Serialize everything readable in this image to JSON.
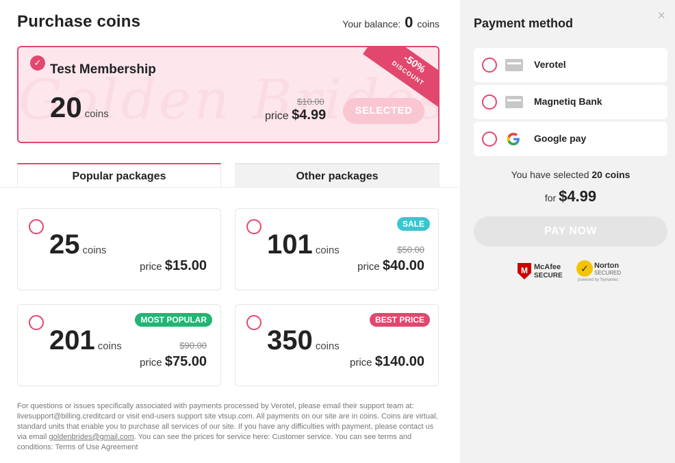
{
  "header": {
    "title": "Purchase coins",
    "balance_label": "Your balance:",
    "balance_value": "0",
    "balance_unit": "coins"
  },
  "membership": {
    "name": "Test Membership",
    "coins": "20",
    "coins_word": "coins",
    "old_price": "$10.00",
    "price_label": "price",
    "price": "$4.99",
    "button": "SELECTED",
    "discount": "-50%",
    "discount_label": "DISCOUNT",
    "watermark": "Golden Brides",
    "checkmark": "✓"
  },
  "tabs": [
    {
      "label": "Popular packages",
      "active": true
    },
    {
      "label": "Other packages",
      "active": false
    }
  ],
  "packages": [
    {
      "coins": "25",
      "coins_word": "coins",
      "old_price": "",
      "price_label": "price",
      "price": "$15.00",
      "badge": ""
    },
    {
      "coins": "101",
      "coins_word": "coins",
      "old_price": "$50.00",
      "price_label": "price",
      "price": "$40.00",
      "badge": "SALE",
      "badge_color": "#3cc4cf"
    },
    {
      "coins": "201",
      "coins_word": "coins",
      "old_price": "$90.00",
      "price_label": "price",
      "price": "$75.00",
      "badge": "MOST POPULAR",
      "badge_color": "#22b573"
    },
    {
      "coins": "350",
      "coins_word": "coins",
      "old_price": "",
      "price_label": "price",
      "price": "$140.00",
      "badge": "BEST PRICE",
      "badge_color": "#e2476d"
    }
  ],
  "footer": {
    "text_1": "For questions or issues specifically associated with payments processed by Verotel, please email their support team at: livesupport@billing.creditcard or visit end-users support site vtsup.com. All payments on our site are in coins. Coins are virtual, standard units that enable you to purchase all services of our site. If you have any difficulties with payment, please contact us via email ",
    "email": "goldenbrides@gmail.com",
    "text_2": ". You can see the prices for service here: Customer service. You can see terms and conditions: Terms of Use Agreement"
  },
  "payment": {
    "title": "Payment method",
    "close": "×",
    "methods": [
      {
        "label": "Verotel",
        "icon": "card-icon"
      },
      {
        "label": "Magnetiq Bank",
        "icon": "card-icon"
      },
      {
        "label": "Google pay",
        "icon": "google-icon"
      }
    ],
    "selected_prefix": "You have selected",
    "selected_coins": "20 coins",
    "for_label": "for",
    "total": "$4.99",
    "pay_button": "PAY NOW",
    "mcafee_1": "McAfee",
    "mcafee_2": "SECURE",
    "norton_1": "Norton",
    "norton_2": "SECURED",
    "norton_3": "powered by Symantec"
  },
  "colors": {
    "accent": "#e2476d",
    "membership_bg": "#fde6ec",
    "panel_bg": "#f2f2f2"
  }
}
